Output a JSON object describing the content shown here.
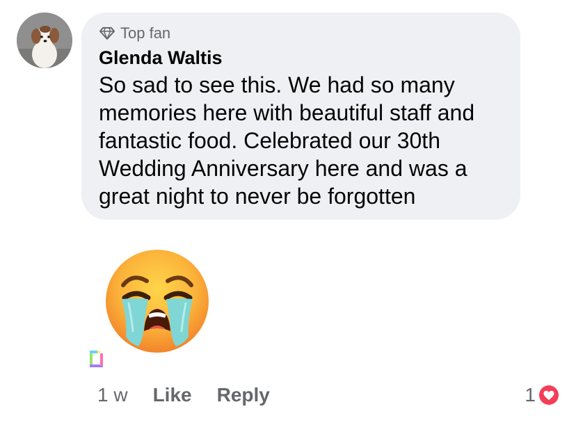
{
  "comment": {
    "badge_label": "Top fan",
    "badge_icon": "diamond-icon",
    "author": "Glenda Waltis",
    "text": "So sad to see this. We had so many memories here with beautiful staff and fantastic food. Celebrated our 30th Wedding Anniversary here and was a great night to never be forgotten",
    "sticker": "loudly-crying-face-emoji",
    "gif_icon": "gif-icon"
  },
  "actions": {
    "time": "1 w",
    "like_label": "Like",
    "reply_label": "Reply"
  },
  "reactions": {
    "count": "1",
    "icon": "love-reaction-icon",
    "color": "#f33e58"
  },
  "colors": {
    "bubble": "#eff0f4",
    "secondary_text": "#65676b",
    "primary_text": "#050505"
  }
}
